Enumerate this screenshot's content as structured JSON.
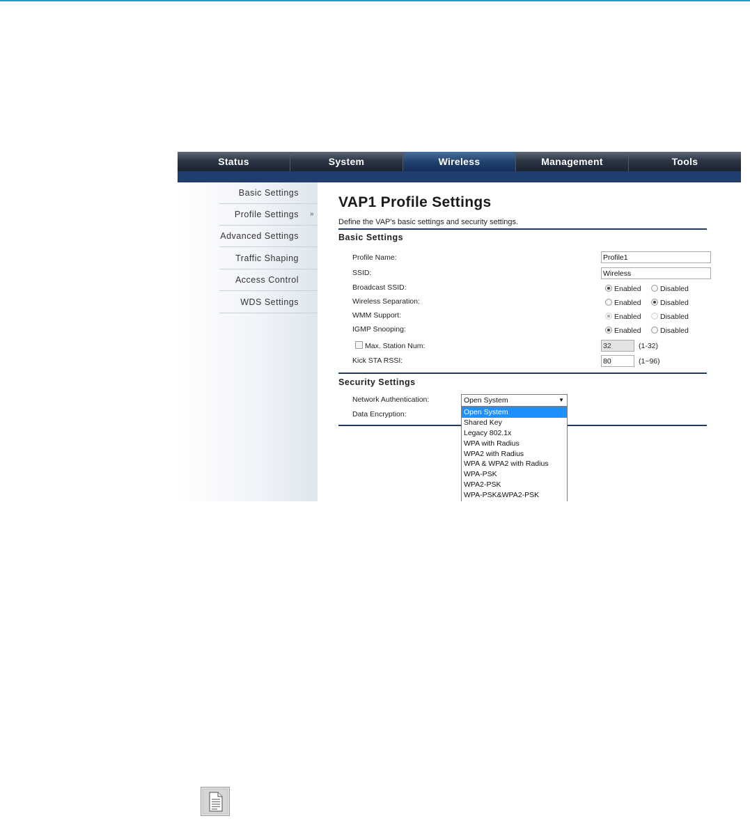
{
  "nav": {
    "tabs": [
      "Status",
      "System",
      "Wireless",
      "Management",
      "Tools"
    ],
    "active_tab": "Wireless"
  },
  "sidebar": {
    "items": [
      "Basic Settings",
      "Profile Settings",
      "Advanced Settings",
      "Traffic Shaping",
      "Access Control",
      "WDS Settings"
    ],
    "active_item": "Profile Settings",
    "active_marker": "»"
  },
  "page": {
    "title": "VAP1 Profile Settings",
    "description": "Define the VAP's basic settings and security settings."
  },
  "basic_settings": {
    "heading": "Basic Settings",
    "profile_name": {
      "label": "Profile Name:",
      "value": "Profile1"
    },
    "ssid": {
      "label": "SSID:",
      "value": "Wireless"
    },
    "broadcast_ssid": {
      "label": "Broadcast SSID:",
      "enabled_label": "Enabled",
      "disabled_label": "Disabled",
      "selected": "Enabled"
    },
    "wireless_separation": {
      "label": "Wireless Separation:",
      "enabled_label": "Enabled",
      "disabled_label": "Disabled",
      "selected": "Disabled"
    },
    "wmm_support": {
      "label": "WMM Support:",
      "enabled_label": "Enabled",
      "disabled_label": "Disabled",
      "selected": "Enabled",
      "disabled": true
    },
    "igmp_snooping": {
      "label": "IGMP Snooping:",
      "enabled_label": "Enabled",
      "disabled_label": "Disabled",
      "selected": "Enabled"
    },
    "max_station": {
      "label": "Max. Station Num:",
      "checked": false,
      "value": "32",
      "range": "(1-32)"
    },
    "kick_sta_rssi": {
      "label": "Kick STA RSSI:",
      "value": "80",
      "range": "(1~96)"
    }
  },
  "security_settings": {
    "heading": "Security Settings",
    "network_authentication": {
      "label": "Network Authentication:",
      "value": "Open System",
      "options": [
        "Open System",
        "Shared Key",
        "Legacy 802.1x",
        "WPA with Radius",
        "WPA2 with Radius",
        "WPA & WPA2 with Radius",
        "WPA-PSK",
        "WPA2-PSK",
        "WPA-PSK&WPA2-PSK"
      ]
    },
    "data_encryption": {
      "label": "Data Encryption:"
    }
  },
  "colors": {
    "accent_line": "#1c9ad6",
    "nav_active": "#1f3f6b",
    "rule": "#1e3a63",
    "dropdown_highlight": "#1e90ff"
  },
  "icons": {
    "note": "document-note-icon"
  }
}
